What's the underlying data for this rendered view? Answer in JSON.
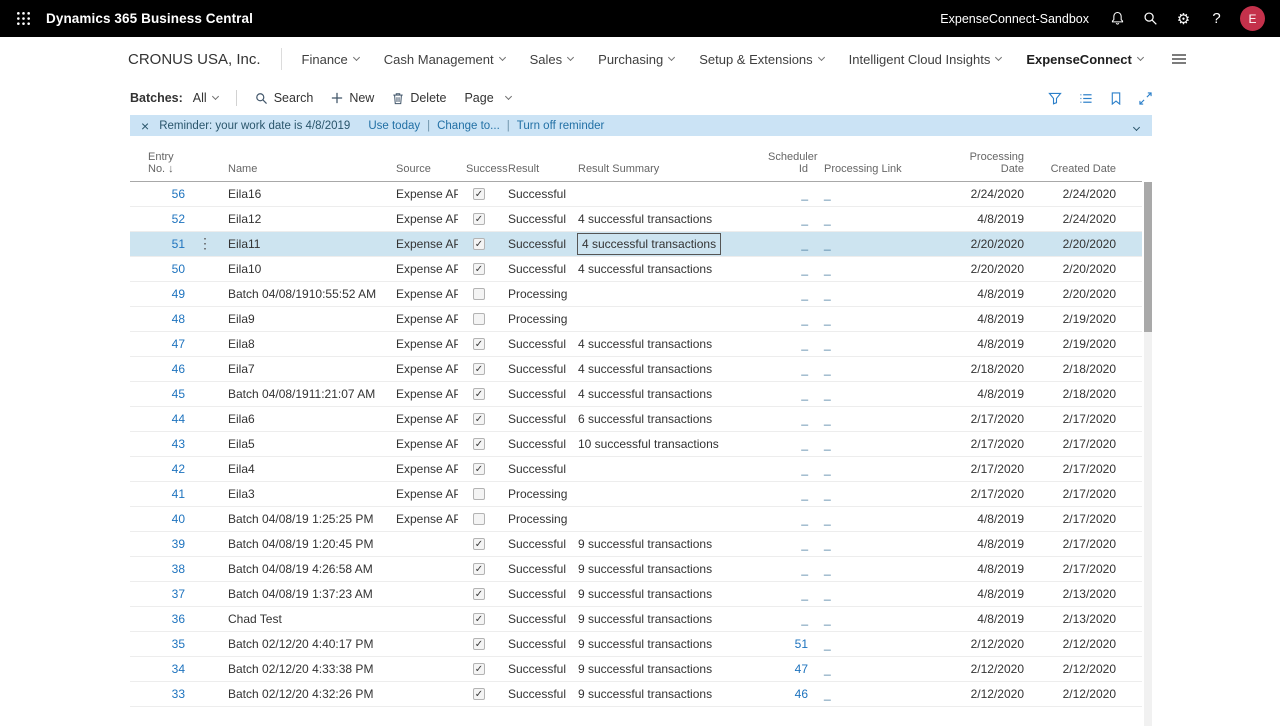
{
  "topbar": {
    "app_title": "Dynamics 365 Business Central",
    "environment": "ExpenseConnect-Sandbox",
    "avatar_initial": "E",
    "icons": [
      "app-launcher-icon",
      "notifications-bell-icon",
      "search-icon",
      "settings-gear-icon",
      "help-icon"
    ]
  },
  "nav": {
    "company": "CRONUS USA, Inc.",
    "items": [
      {
        "label": "Finance"
      },
      {
        "label": "Cash Management"
      },
      {
        "label": "Sales"
      },
      {
        "label": "Purchasing"
      },
      {
        "label": "Setup & Extensions"
      },
      {
        "label": "Intelligent Cloud Insights"
      },
      {
        "label": "ExpenseConnect",
        "active": true
      }
    ]
  },
  "toolbar": {
    "filter_label": "Batches:",
    "filter_value": "All",
    "actions": [
      {
        "label": "Search",
        "icon": "search-icon"
      },
      {
        "label": "New",
        "icon": "plus-icon"
      },
      {
        "label": "Delete",
        "icon": "trash-icon"
      },
      {
        "label": "Page",
        "icon": "chevron-down-icon"
      }
    ],
    "view_icons": [
      "filter-icon",
      "list-view-icon",
      "bookmark-icon",
      "expand-icon"
    ]
  },
  "banner": {
    "message": "Reminder: your work date is 4/8/2019",
    "links": [
      "Use today",
      "Change to...",
      "Turn off reminder"
    ]
  },
  "table": {
    "columns": [
      "Entry No.",
      "Name",
      "Source",
      "Success",
      "Result",
      "Result Summary",
      "Scheduler Id",
      "Processing Link",
      "Processing Date",
      "Created Date"
    ],
    "sort": {
      "column": "Entry No.",
      "direction": "descending",
      "arrow": "↓"
    },
    "rows": [
      {
        "entry_no": "56",
        "name": "Eila16",
        "source": "Expense API",
        "success": true,
        "result": "Successful",
        "result_summary": "",
        "scheduler_id": "_",
        "processing_link": "_",
        "processing_date": "2/24/2020",
        "created_date": "2/24/2020"
      },
      {
        "entry_no": "52",
        "name": "Eila12",
        "source": "Expense API",
        "success": true,
        "result": "Successful",
        "result_summary": "4 successful transactions",
        "scheduler_id": "_",
        "processing_link": "_",
        "processing_date": "4/8/2019",
        "created_date": "2/24/2020"
      },
      {
        "entry_no": "51",
        "name": "Eila11",
        "source": "Expense API",
        "success": true,
        "result": "Successful",
        "result_summary": "4 successful transactions",
        "scheduler_id": "_",
        "processing_link": "_",
        "processing_date": "2/20/2020",
        "created_date": "2/20/2020",
        "selected": true,
        "focused": true
      },
      {
        "entry_no": "50",
        "name": "Eila10",
        "source": "Expense API",
        "success": true,
        "result": "Successful",
        "result_summary": "4 successful transactions",
        "scheduler_id": "_",
        "processing_link": "_",
        "processing_date": "2/20/2020",
        "created_date": "2/20/2020"
      },
      {
        "entry_no": "49",
        "name": "Batch 04/08/1910:55:52 AM",
        "source": "Expense API",
        "success": false,
        "result": "Processing",
        "result_summary": "",
        "scheduler_id": "_",
        "processing_link": "_",
        "processing_date": "4/8/2019",
        "created_date": "2/20/2020"
      },
      {
        "entry_no": "48",
        "name": "Eila9",
        "source": "Expense API",
        "success": false,
        "result": "Processing",
        "result_summary": "",
        "scheduler_id": "_",
        "processing_link": "_",
        "processing_date": "4/8/2019",
        "created_date": "2/19/2020"
      },
      {
        "entry_no": "47",
        "name": "Eila8",
        "source": "Expense API",
        "success": true,
        "result": "Successful",
        "result_summary": "4 successful transactions",
        "scheduler_id": "_",
        "processing_link": "_",
        "processing_date": "4/8/2019",
        "created_date": "2/19/2020"
      },
      {
        "entry_no": "46",
        "name": "Eila7",
        "source": "Expense API",
        "success": true,
        "result": "Successful",
        "result_summary": "4 successful transactions",
        "scheduler_id": "_",
        "processing_link": "_",
        "processing_date": "2/18/2020",
        "created_date": "2/18/2020"
      },
      {
        "entry_no": "45",
        "name": "Batch 04/08/1911:21:07 AM",
        "source": "Expense API",
        "success": true,
        "result": "Successful",
        "result_summary": "4 successful transactions",
        "scheduler_id": "_",
        "processing_link": "_",
        "processing_date": "4/8/2019",
        "created_date": "2/18/2020"
      },
      {
        "entry_no": "44",
        "name": "Eila6",
        "source": "Expense API",
        "success": true,
        "result": "Successful",
        "result_summary": "6 successful transactions",
        "scheduler_id": "_",
        "processing_link": "_",
        "processing_date": "2/17/2020",
        "created_date": "2/17/2020"
      },
      {
        "entry_no": "43",
        "name": "Eila5",
        "source": "Expense API",
        "success": true,
        "result": "Successful",
        "result_summary": "10 successful transactions",
        "scheduler_id": "_",
        "processing_link": "_",
        "processing_date": "2/17/2020",
        "created_date": "2/17/2020"
      },
      {
        "entry_no": "42",
        "name": "Eila4",
        "source": "Expense API",
        "success": true,
        "result": "Successful",
        "result_summary": "",
        "scheduler_id": "_",
        "processing_link": "_",
        "processing_date": "2/17/2020",
        "created_date": "2/17/2020"
      },
      {
        "entry_no": "41",
        "name": "Eila3",
        "source": "Expense API",
        "success": false,
        "result": "Processing",
        "result_summary": "",
        "scheduler_id": "_",
        "processing_link": "_",
        "processing_date": "2/17/2020",
        "created_date": "2/17/2020"
      },
      {
        "entry_no": "40",
        "name": "Batch 04/08/19 1:25:25 PM",
        "source": "Expense API",
        "success": false,
        "result": "Processing",
        "result_summary": "",
        "scheduler_id": "_",
        "processing_link": "_",
        "processing_date": "4/8/2019",
        "created_date": "2/17/2020"
      },
      {
        "entry_no": "39",
        "name": "Batch 04/08/19 1:20:45 PM",
        "source": "",
        "success": true,
        "result": "Successful",
        "result_summary": "9 successful transactions",
        "scheduler_id": "_",
        "processing_link": "_",
        "processing_date": "4/8/2019",
        "created_date": "2/17/2020"
      },
      {
        "entry_no": "38",
        "name": "Batch 04/08/19 4:26:58 AM",
        "source": "",
        "success": true,
        "result": "Successful",
        "result_summary": "9 successful transactions",
        "scheduler_id": "_",
        "processing_link": "_",
        "processing_date": "4/8/2019",
        "created_date": "2/17/2020"
      },
      {
        "entry_no": "37",
        "name": "Batch 04/08/19 1:37:23 AM",
        "source": "",
        "success": true,
        "result": "Successful",
        "result_summary": "9 successful transactions",
        "scheduler_id": "_",
        "processing_link": "_",
        "processing_date": "4/8/2019",
        "created_date": "2/13/2020"
      },
      {
        "entry_no": "36",
        "name": "Chad Test",
        "source": "",
        "success": true,
        "result": "Successful",
        "result_summary": "9 successful transactions",
        "scheduler_id": "_",
        "processing_link": "_",
        "processing_date": "4/8/2019",
        "created_date": "2/13/2020"
      },
      {
        "entry_no": "35",
        "name": "Batch 02/12/20 4:40:17 PM",
        "source": "",
        "success": true,
        "result": "Successful",
        "result_summary": "9 successful transactions",
        "scheduler_id": "51",
        "processing_link": "_",
        "processing_date": "2/12/2020",
        "created_date": "2/12/2020"
      },
      {
        "entry_no": "34",
        "name": "Batch 02/12/20 4:33:38 PM",
        "source": "",
        "success": true,
        "result": "Successful",
        "result_summary": "9 successful transactions",
        "scheduler_id": "47",
        "processing_link": "_",
        "processing_date": "2/12/2020",
        "created_date": "2/12/2020"
      },
      {
        "entry_no": "33",
        "name": "Batch 02/12/20 4:32:26 PM",
        "source": "",
        "success": true,
        "result": "Successful",
        "result_summary": "9 successful transactions",
        "scheduler_id": "46",
        "processing_link": "_",
        "processing_date": "2/12/2020",
        "created_date": "2/12/2020"
      }
    ]
  },
  "colors": {
    "accent_blue": "#1e73be",
    "banner_bg": "#cbe3f5",
    "selected_row_bg": "#cde4f0",
    "avatar_bg": "#c4314b",
    "topbar_bg": "#000000"
  }
}
